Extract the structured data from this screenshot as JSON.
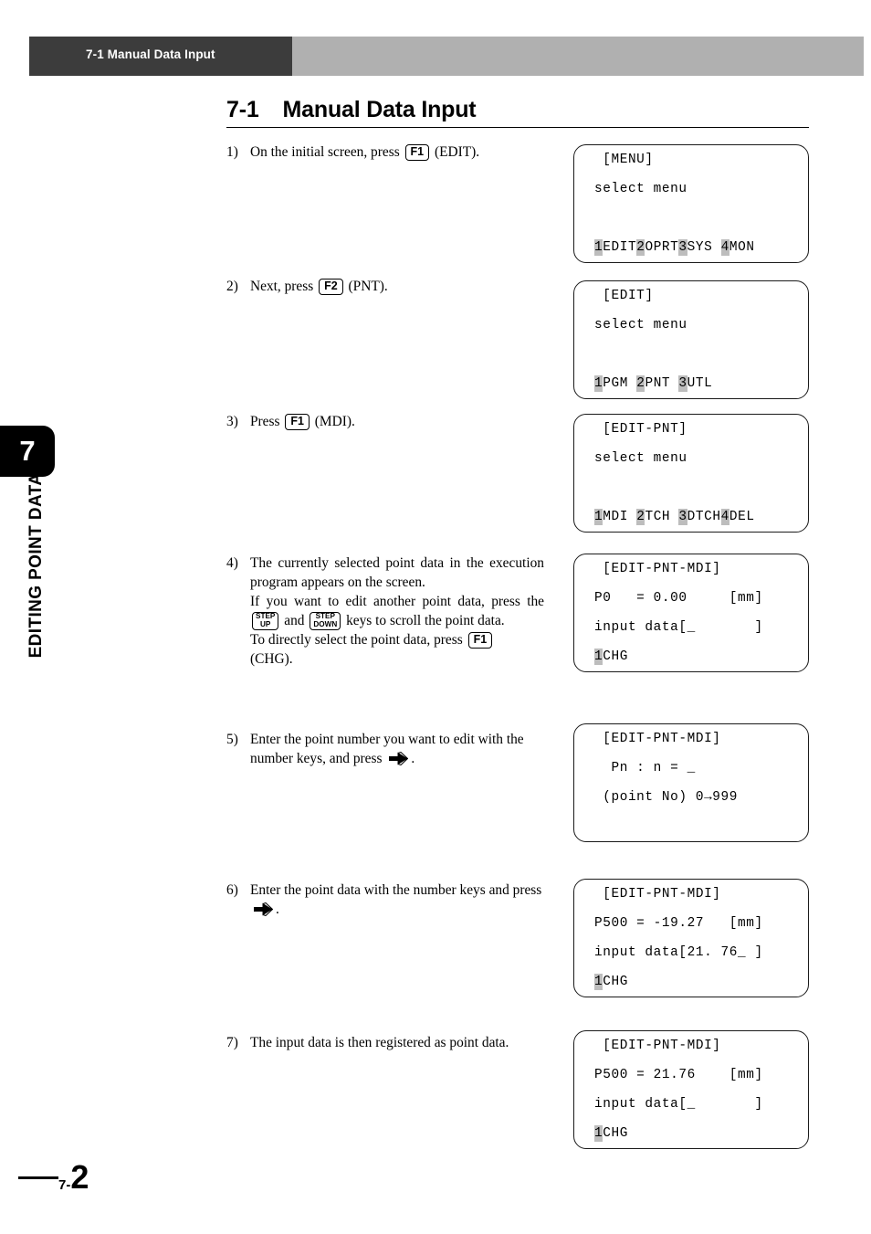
{
  "header": {
    "running_title": "7-1 Manual Data Input"
  },
  "section": {
    "number": "7-1",
    "title": "Manual Data Input"
  },
  "side_tab": {
    "chapter_number": "7",
    "chapter_label": "EDITING POINT DATA"
  },
  "steps": [
    {
      "num": "1)",
      "parts": [
        {
          "t": "text",
          "v": "On the initial screen, press "
        },
        {
          "t": "key",
          "v": "F1"
        },
        {
          "t": "text",
          "v": " (EDIT)."
        }
      ]
    },
    {
      "num": "2)",
      "parts": [
        {
          "t": "text",
          "v": "Next, press "
        },
        {
          "t": "key",
          "v": "F2"
        },
        {
          "t": "text",
          "v": " (PNT)."
        }
      ]
    },
    {
      "num": "3)",
      "parts": [
        {
          "t": "text",
          "v": "Press "
        },
        {
          "t": "key",
          "v": "F1"
        },
        {
          "t": "text",
          "v": " (MDI)."
        }
      ]
    },
    {
      "num": "4)",
      "para1": "The currently selected point data in the execution program appears on the screen.",
      "para2_a": "If you want to edit another point data, press the ",
      "key_step_up_line1": "STEP",
      "key_step_up_line2": "UP",
      "para2_b": " and ",
      "key_step_down_line1": "STEP",
      "key_step_down_line2": "DOWN",
      "para2_c": " keys to scroll the point data.",
      "para3_a": "To directly select the point data, press ",
      "key_f1": "F1",
      "para3_b": "(CHG)."
    },
    {
      "num": "5)",
      "para_a": "Enter the point number you want to edit with the number keys, and press ",
      "para_b": "."
    },
    {
      "num": "6)",
      "para_a": "Enter the point data with the number keys and press ",
      "para_b": "."
    },
    {
      "num": "7)",
      "para_a": "The input data is then registered as point data."
    }
  ],
  "lcd_panels": [
    {
      "name": "menu-screen",
      "rows": [
        [
          {
            "t": "plain",
            "v": " [MENU]"
          }
        ],
        [
          {
            "t": "plain",
            "v": "select menu"
          }
        ],
        [
          {
            "t": "plain",
            "v": ""
          }
        ],
        [
          {
            "t": "hl",
            "v": "1"
          },
          {
            "t": "plain",
            "v": "EDIT"
          },
          {
            "t": "hl",
            "v": "2"
          },
          {
            "t": "plain",
            "v": "OPRT"
          },
          {
            "t": "hl",
            "v": "3"
          },
          {
            "t": "plain",
            "v": "SYS "
          },
          {
            "t": "hl",
            "v": "4"
          },
          {
            "t": "plain",
            "v": "MON"
          }
        ]
      ]
    },
    {
      "name": "edit-screen",
      "rows": [
        [
          {
            "t": "plain",
            "v": " [EDIT]"
          }
        ],
        [
          {
            "t": "plain",
            "v": "select menu"
          }
        ],
        [
          {
            "t": "plain",
            "v": ""
          }
        ],
        [
          {
            "t": "hl",
            "v": "1"
          },
          {
            "t": "plain",
            "v": "PGM "
          },
          {
            "t": "hl",
            "v": "2"
          },
          {
            "t": "plain",
            "v": "PNT "
          },
          {
            "t": "hl",
            "v": "3"
          },
          {
            "t": "plain",
            "v": "UTL"
          }
        ]
      ]
    },
    {
      "name": "edit-pnt-screen",
      "rows": [
        [
          {
            "t": "plain",
            "v": " [EDIT-PNT]"
          }
        ],
        [
          {
            "t": "plain",
            "v": "select menu"
          }
        ],
        [
          {
            "t": "plain",
            "v": ""
          }
        ],
        [
          {
            "t": "hl",
            "v": "1"
          },
          {
            "t": "plain",
            "v": "MDI "
          },
          {
            "t": "hl",
            "v": "2"
          },
          {
            "t": "plain",
            "v": "TCH "
          },
          {
            "t": "hl",
            "v": "3"
          },
          {
            "t": "plain",
            "v": "DTCH"
          },
          {
            "t": "hl",
            "v": "4"
          },
          {
            "t": "plain",
            "v": "DEL"
          }
        ]
      ]
    },
    {
      "name": "edit-pnt-mdi-p0-screen",
      "rows": [
        [
          {
            "t": "plain",
            "v": " [EDIT-PNT-MDI]"
          }
        ],
        [
          {
            "t": "plain",
            "v": "P0   = 0.00     [mm]"
          }
        ],
        [
          {
            "t": "plain",
            "v": "input data[_       ]"
          }
        ],
        [
          {
            "t": "hl",
            "v": "1"
          },
          {
            "t": "plain",
            "v": "CHG"
          }
        ]
      ]
    },
    {
      "name": "edit-pnt-mdi-pointno-screen",
      "rows": [
        [
          {
            "t": "plain",
            "v": " [EDIT-PNT-MDI]"
          }
        ],
        [
          {
            "t": "plain",
            "v": "  Pn : n = _"
          }
        ],
        [
          {
            "t": "plain",
            "v": " (point No) 0→999"
          }
        ],
        [
          {
            "t": "plain",
            "v": ""
          }
        ]
      ]
    },
    {
      "name": "edit-pnt-mdi-p500-input-screen",
      "rows": [
        [
          {
            "t": "plain",
            "v": " [EDIT-PNT-MDI]"
          }
        ],
        [
          {
            "t": "plain",
            "v": "P500 = -19.27   [mm]"
          }
        ],
        [
          {
            "t": "plain",
            "v": "input data[21. 76_ ]"
          }
        ],
        [
          {
            "t": "hl",
            "v": "1"
          },
          {
            "t": "plain",
            "v": "CHG"
          }
        ]
      ]
    },
    {
      "name": "edit-pnt-mdi-p500-registered-screen",
      "rows": [
        [
          {
            "t": "plain",
            "v": " [EDIT-PNT-MDI]"
          }
        ],
        [
          {
            "t": "plain",
            "v": "P500 = 21.76    [mm]"
          }
        ],
        [
          {
            "t": "plain",
            "v": "input data[_       ]"
          }
        ],
        [
          {
            "t": "hl",
            "v": "1"
          },
          {
            "t": "plain",
            "v": "CHG"
          }
        ]
      ]
    }
  ],
  "footer": {
    "page_prefix": "7-",
    "page_number": "2"
  },
  "colors": {
    "header_black": "#3c3c3c",
    "header_gray": "#b0b0b0",
    "highlight_gray": "#bdbdbd",
    "tab_black": "#000000"
  }
}
